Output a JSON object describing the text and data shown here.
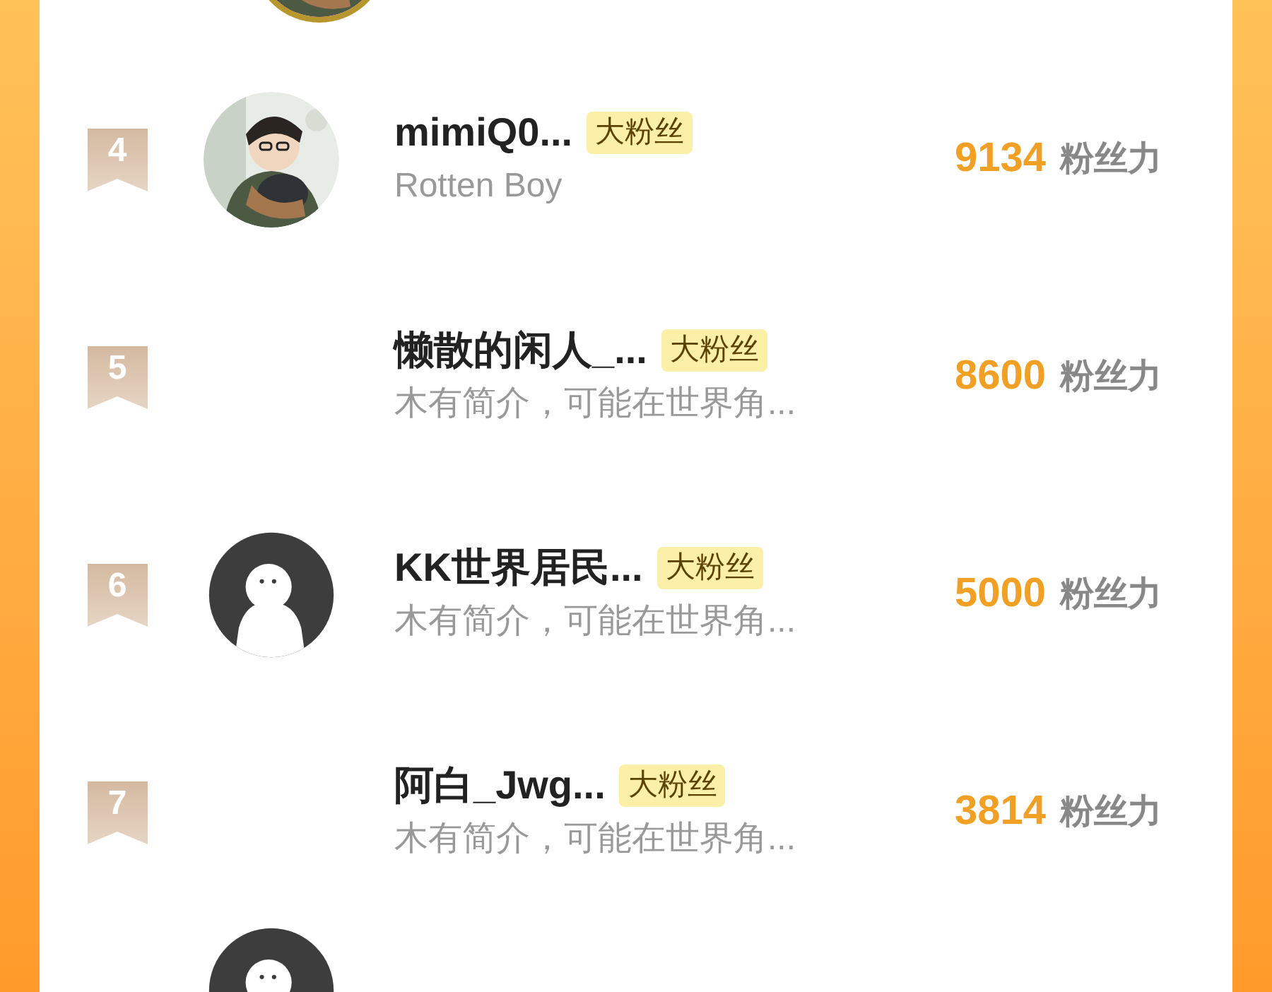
{
  "rows": [
    {
      "rank": "4",
      "name": "mimiQ0...",
      "tag": "大粉丝",
      "bio": "Rotten Boy",
      "score": "9134",
      "unit": "粉丝力"
    },
    {
      "rank": "5",
      "name": "懒散的闲人_...",
      "tag": "大粉丝",
      "bio": "木有简介，可能在世界角...",
      "score": "8600",
      "unit": "粉丝力"
    },
    {
      "rank": "6",
      "avatar": {
        "kind": "default"
      },
      "name": "KK世界居民...",
      "tag": "大粉丝",
      "bio": "木有简介，可能在世界角...",
      "score": "5000",
      "unit": "粉丝力"
    },
    {
      "rank": "7",
      "name": "阿白_Jwg...",
      "tag": "大粉丝",
      "bio": "木有简介，可能在世界角...",
      "score": "3814",
      "unit": "粉丝力"
    }
  ],
  "bottom_entry": {
    "avatar": {
      "kind": "default"
    }
  }
}
